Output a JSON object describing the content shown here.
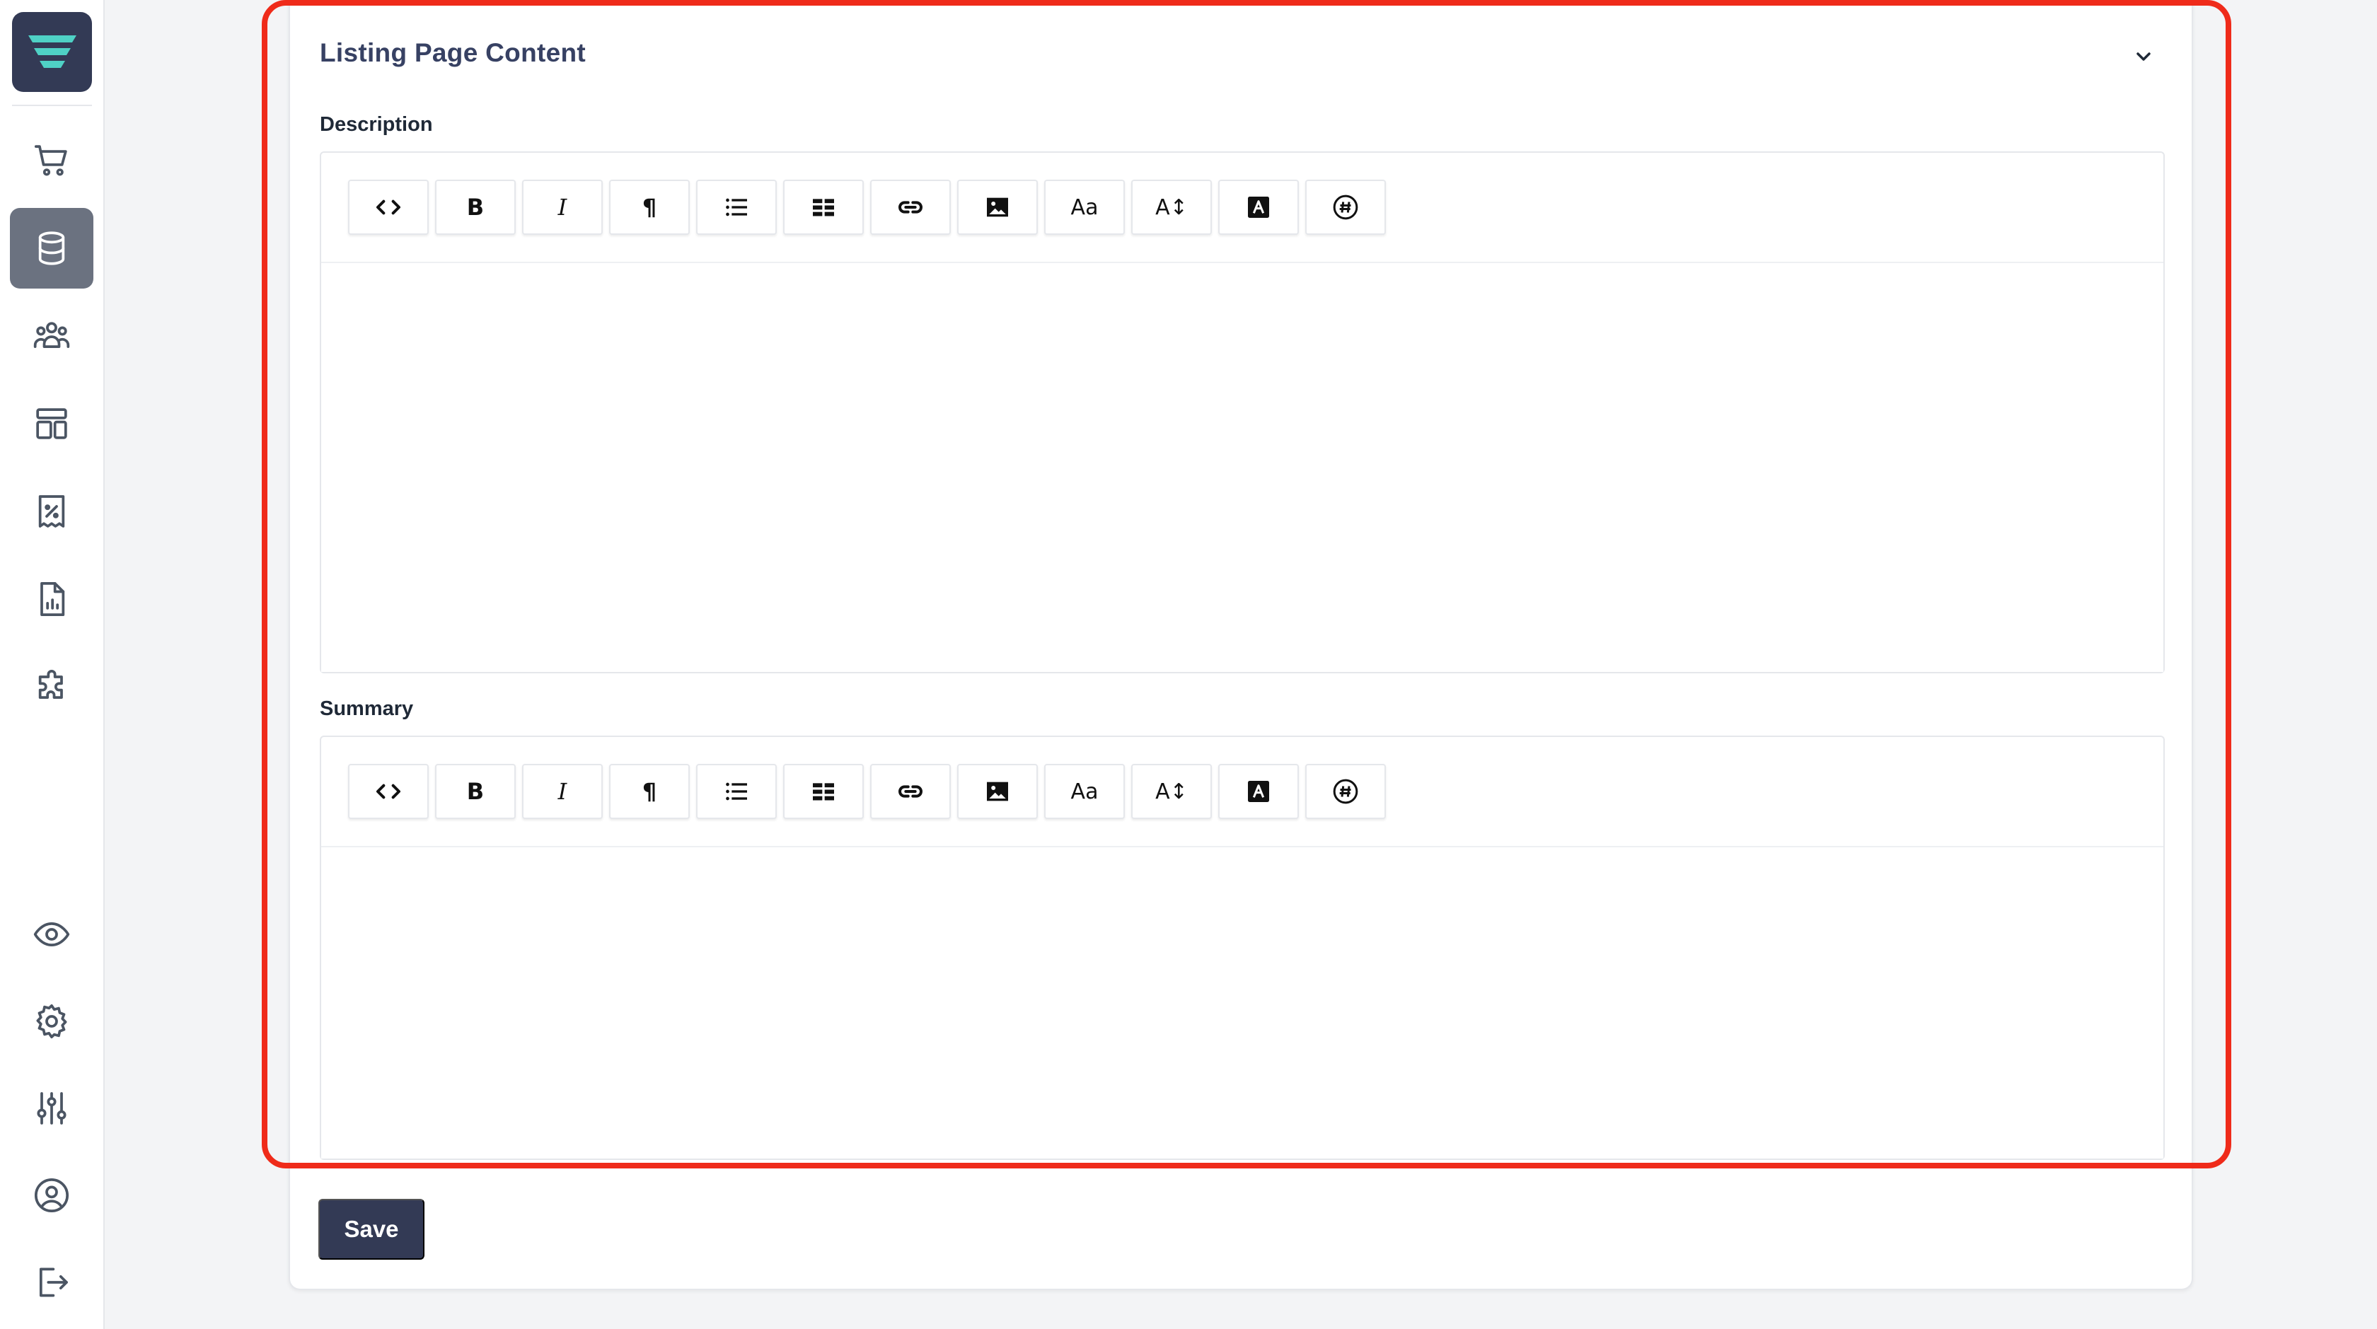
{
  "sidebar": {
    "logo": "app-logo",
    "items": [
      {
        "icon": "shopping-cart-icon",
        "active": false
      },
      {
        "icon": "database-icon",
        "active": true
      },
      {
        "icon": "users-icon",
        "active": false
      },
      {
        "icon": "layout-icon",
        "active": false
      },
      {
        "icon": "discount-receipt-icon",
        "active": false
      },
      {
        "icon": "report-file-icon",
        "active": false
      },
      {
        "icon": "puzzle-icon",
        "active": false
      },
      {
        "icon": "eye-icon",
        "active": false
      },
      {
        "icon": "gear-icon",
        "active": false
      },
      {
        "icon": "sliders-icon",
        "active": false
      },
      {
        "icon": "user-circle-icon",
        "active": false
      },
      {
        "icon": "logout-icon",
        "active": false
      }
    ]
  },
  "section": {
    "title": "Listing Page Content",
    "collapse_icon": "chevron-down-icon"
  },
  "description": {
    "label": "Description",
    "content": ""
  },
  "summary": {
    "label": "Summary",
    "content": ""
  },
  "toolbar": {
    "buttons": [
      {
        "name": "code-view",
        "glyph": "<>"
      },
      {
        "name": "bold",
        "glyph": "B"
      },
      {
        "name": "italic",
        "glyph": "I"
      },
      {
        "name": "paragraph",
        "glyph": "¶"
      },
      {
        "name": "bulleted-list",
        "glyph": ""
      },
      {
        "name": "table",
        "glyph": ""
      },
      {
        "name": "link",
        "glyph": ""
      },
      {
        "name": "image",
        "glyph": ""
      },
      {
        "name": "font-size",
        "glyph": "Aa"
      },
      {
        "name": "line-height",
        "glyph": "A↕"
      },
      {
        "name": "text-color",
        "glyph": "A"
      },
      {
        "name": "special-characters",
        "glyph": "#"
      }
    ]
  },
  "actions": {
    "save_label": "Save"
  },
  "colors": {
    "brand_dark": "#333a55",
    "brand_accent": "#4fd1c5",
    "highlight": "#ef2b1a",
    "title": "#374163"
  }
}
